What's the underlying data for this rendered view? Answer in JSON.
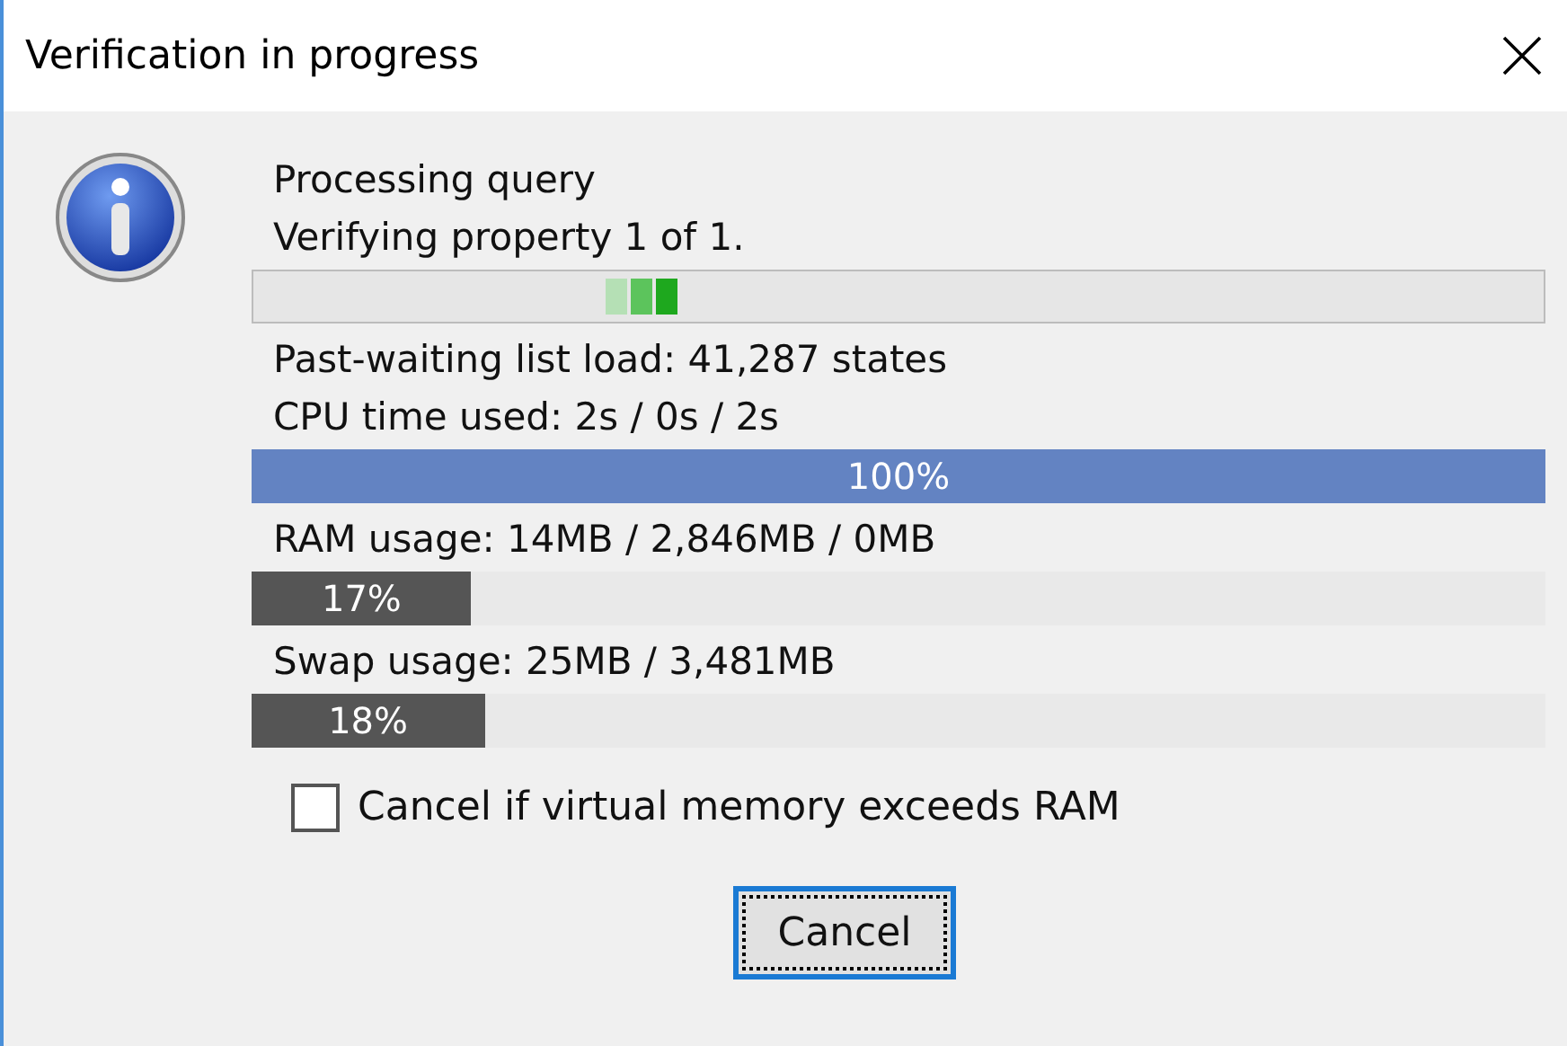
{
  "window": {
    "title": "Verification in progress"
  },
  "items": [
    {
      "kind": "text",
      "text": "Processing query"
    },
    {
      "kind": "text",
      "text": "Verifying property 1 of 1."
    },
    {
      "kind": "busy"
    },
    {
      "kind": "text",
      "text": "Past-waiting list load: 41,287 states"
    },
    {
      "kind": "text",
      "text": "CPU time used: 2s / 0s / 2s"
    },
    {
      "kind": "bar",
      "color": "#6383c2",
      "level": 1,
      "reading": "100%"
    },
    {
      "kind": "text",
      "text": "RAM usage: 14MB / 2,846MB / 0MB"
    },
    {
      "kind": "bar",
      "color": "#555555",
      "level": 0.17,
      "reading": "17%"
    },
    {
      "kind": "text",
      "text": "Swap usage: 25MB / 3,481MB"
    },
    {
      "kind": "bar",
      "color": "#555555",
      "level": 0.18,
      "reading": "18%"
    }
  ],
  "option": {
    "label": "Cancel if virtual memory exceeds RAM",
    "checked": false
  },
  "button": {
    "label": "Cancel"
  }
}
